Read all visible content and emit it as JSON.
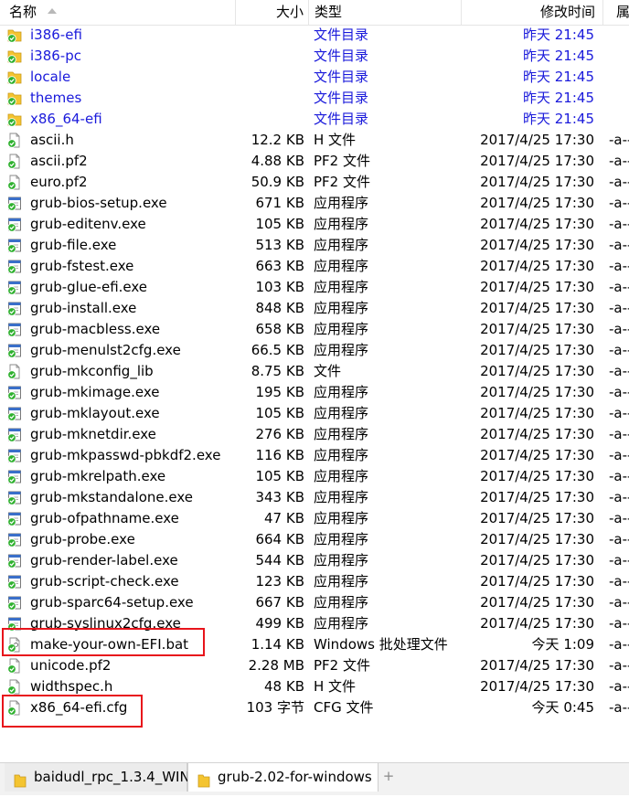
{
  "header": {
    "name": "名称",
    "size": "大小",
    "type": "类型",
    "modified": "修改时间",
    "attr": "属"
  },
  "files": [
    {
      "kind": "folder",
      "name": "i386-efi",
      "size": "",
      "type": "文件目录",
      "date": "昨天",
      "time": "21:45",
      "attr": ""
    },
    {
      "kind": "folder",
      "name": "i386-pc",
      "size": "",
      "type": "文件目录",
      "date": "昨天",
      "time": "21:45",
      "attr": ""
    },
    {
      "kind": "folder",
      "name": "locale",
      "size": "",
      "type": "文件目录",
      "date": "昨天",
      "time": "21:45",
      "attr": ""
    },
    {
      "kind": "folder",
      "name": "themes",
      "size": "",
      "type": "文件目录",
      "date": "昨天",
      "time": "21:45",
      "attr": ""
    },
    {
      "kind": "folder",
      "name": "x86_64-efi",
      "size": "",
      "type": "文件目录",
      "date": "昨天",
      "time": "21:45",
      "attr": ""
    },
    {
      "kind": "file",
      "name": "ascii.h",
      "size": "12.2 KB",
      "type": "H 文件",
      "date": "2017/4/25",
      "time": "17:30",
      "attr": "-a--"
    },
    {
      "kind": "file",
      "name": "ascii.pf2",
      "size": "4.88 KB",
      "type": "PF2 文件",
      "date": "2017/4/25",
      "time": "17:30",
      "attr": "-a--"
    },
    {
      "kind": "file",
      "name": "euro.pf2",
      "size": "50.9 KB",
      "type": "PF2 文件",
      "date": "2017/4/25",
      "time": "17:30",
      "attr": "-a--"
    },
    {
      "kind": "exe",
      "name": "grub-bios-setup.exe",
      "size": "671 KB",
      "type": "应用程序",
      "date": "2017/4/25",
      "time": "17:30",
      "attr": "-a--"
    },
    {
      "kind": "exe",
      "name": "grub-editenv.exe",
      "size": "105 KB",
      "type": "应用程序",
      "date": "2017/4/25",
      "time": "17:30",
      "attr": "-a--"
    },
    {
      "kind": "exe",
      "name": "grub-file.exe",
      "size": "513 KB",
      "type": "应用程序",
      "date": "2017/4/25",
      "time": "17:30",
      "attr": "-a--"
    },
    {
      "kind": "exe",
      "name": "grub-fstest.exe",
      "size": "663 KB",
      "type": "应用程序",
      "date": "2017/4/25",
      "time": "17:30",
      "attr": "-a--"
    },
    {
      "kind": "exe",
      "name": "grub-glue-efi.exe",
      "size": "103 KB",
      "type": "应用程序",
      "date": "2017/4/25",
      "time": "17:30",
      "attr": "-a--"
    },
    {
      "kind": "exe",
      "name": "grub-install.exe",
      "size": "848 KB",
      "type": "应用程序",
      "date": "2017/4/25",
      "time": "17:30",
      "attr": "-a--"
    },
    {
      "kind": "exe",
      "name": "grub-macbless.exe",
      "size": "658 KB",
      "type": "应用程序",
      "date": "2017/4/25",
      "time": "17:30",
      "attr": "-a--"
    },
    {
      "kind": "exe",
      "name": "grub-menulst2cfg.exe",
      "size": "66.5 KB",
      "type": "应用程序",
      "date": "2017/4/25",
      "time": "17:30",
      "attr": "-a--"
    },
    {
      "kind": "file",
      "name": "grub-mkconfig_lib",
      "size": "8.75 KB",
      "type": "文件",
      "date": "2017/4/25",
      "time": "17:30",
      "attr": "-a--"
    },
    {
      "kind": "exe",
      "name": "grub-mkimage.exe",
      "size": "195 KB",
      "type": "应用程序",
      "date": "2017/4/25",
      "time": "17:30",
      "attr": "-a--"
    },
    {
      "kind": "exe",
      "name": "grub-mklayout.exe",
      "size": "105 KB",
      "type": "应用程序",
      "date": "2017/4/25",
      "time": "17:30",
      "attr": "-a--"
    },
    {
      "kind": "exe",
      "name": "grub-mknetdir.exe",
      "size": "276 KB",
      "type": "应用程序",
      "date": "2017/4/25",
      "time": "17:30",
      "attr": "-a--"
    },
    {
      "kind": "exe",
      "name": "grub-mkpasswd-pbkdf2.exe",
      "size": "116 KB",
      "type": "应用程序",
      "date": "2017/4/25",
      "time": "17:30",
      "attr": "-a--"
    },
    {
      "kind": "exe",
      "name": "grub-mkrelpath.exe",
      "size": "105 KB",
      "type": "应用程序",
      "date": "2017/4/25",
      "time": "17:30",
      "attr": "-a--"
    },
    {
      "kind": "exe",
      "name": "grub-mkstandalone.exe",
      "size": "343 KB",
      "type": "应用程序",
      "date": "2017/4/25",
      "time": "17:30",
      "attr": "-a--"
    },
    {
      "kind": "exe",
      "name": "grub-ofpathname.exe",
      "size": "47 KB",
      "type": "应用程序",
      "date": "2017/4/25",
      "time": "17:30",
      "attr": "-a--"
    },
    {
      "kind": "exe",
      "name": "grub-probe.exe",
      "size": "664 KB",
      "type": "应用程序",
      "date": "2017/4/25",
      "time": "17:30",
      "attr": "-a--"
    },
    {
      "kind": "exe",
      "name": "grub-render-label.exe",
      "size": "544 KB",
      "type": "应用程序",
      "date": "2017/4/25",
      "time": "17:30",
      "attr": "-a--"
    },
    {
      "kind": "exe",
      "name": "grub-script-check.exe",
      "size": "123 KB",
      "type": "应用程序",
      "date": "2017/4/25",
      "time": "17:30",
      "attr": "-a--"
    },
    {
      "kind": "exe",
      "name": "grub-sparc64-setup.exe",
      "size": "667 KB",
      "type": "应用程序",
      "date": "2017/4/25",
      "time": "17:30",
      "attr": "-a--"
    },
    {
      "kind": "exe",
      "name": "grub-syslinux2cfg.exe",
      "size": "499 KB",
      "type": "应用程序",
      "date": "2017/4/25",
      "time": "17:30",
      "attr": "-a--"
    },
    {
      "kind": "bat",
      "name": "make-your-own-EFI.bat",
      "size": "1.14 KB",
      "type": "Windows 批处理文件",
      "date": "今天",
      "time": "1:09",
      "attr": "-a--"
    },
    {
      "kind": "file",
      "name": "unicode.pf2",
      "size": "2.28 MB",
      "type": "PF2 文件",
      "date": "2017/4/25",
      "time": "17:30",
      "attr": "-a--"
    },
    {
      "kind": "file",
      "name": "widthspec.h",
      "size": "48 KB",
      "type": "H 文件",
      "date": "2017/4/25",
      "time": "17:30",
      "attr": "-a--"
    },
    {
      "kind": "file",
      "name": "x86_64-efi.cfg",
      "size": "103 字节",
      "type": "CFG 文件",
      "date": "今天",
      "time": "0:45",
      "attr": "-a--"
    }
  ],
  "tabs": [
    {
      "label": "baidudl_rpc_1.3.4_WIN",
      "active": false
    },
    {
      "label": "grub-2.02-for-windows",
      "active": true
    }
  ],
  "new_tab_label": "+",
  "colors": {
    "folder_text": "#1a1adb",
    "highlight_box": "#e8141b",
    "sync_badge": "#2fb12f",
    "folder_icon": "#f4c430"
  }
}
